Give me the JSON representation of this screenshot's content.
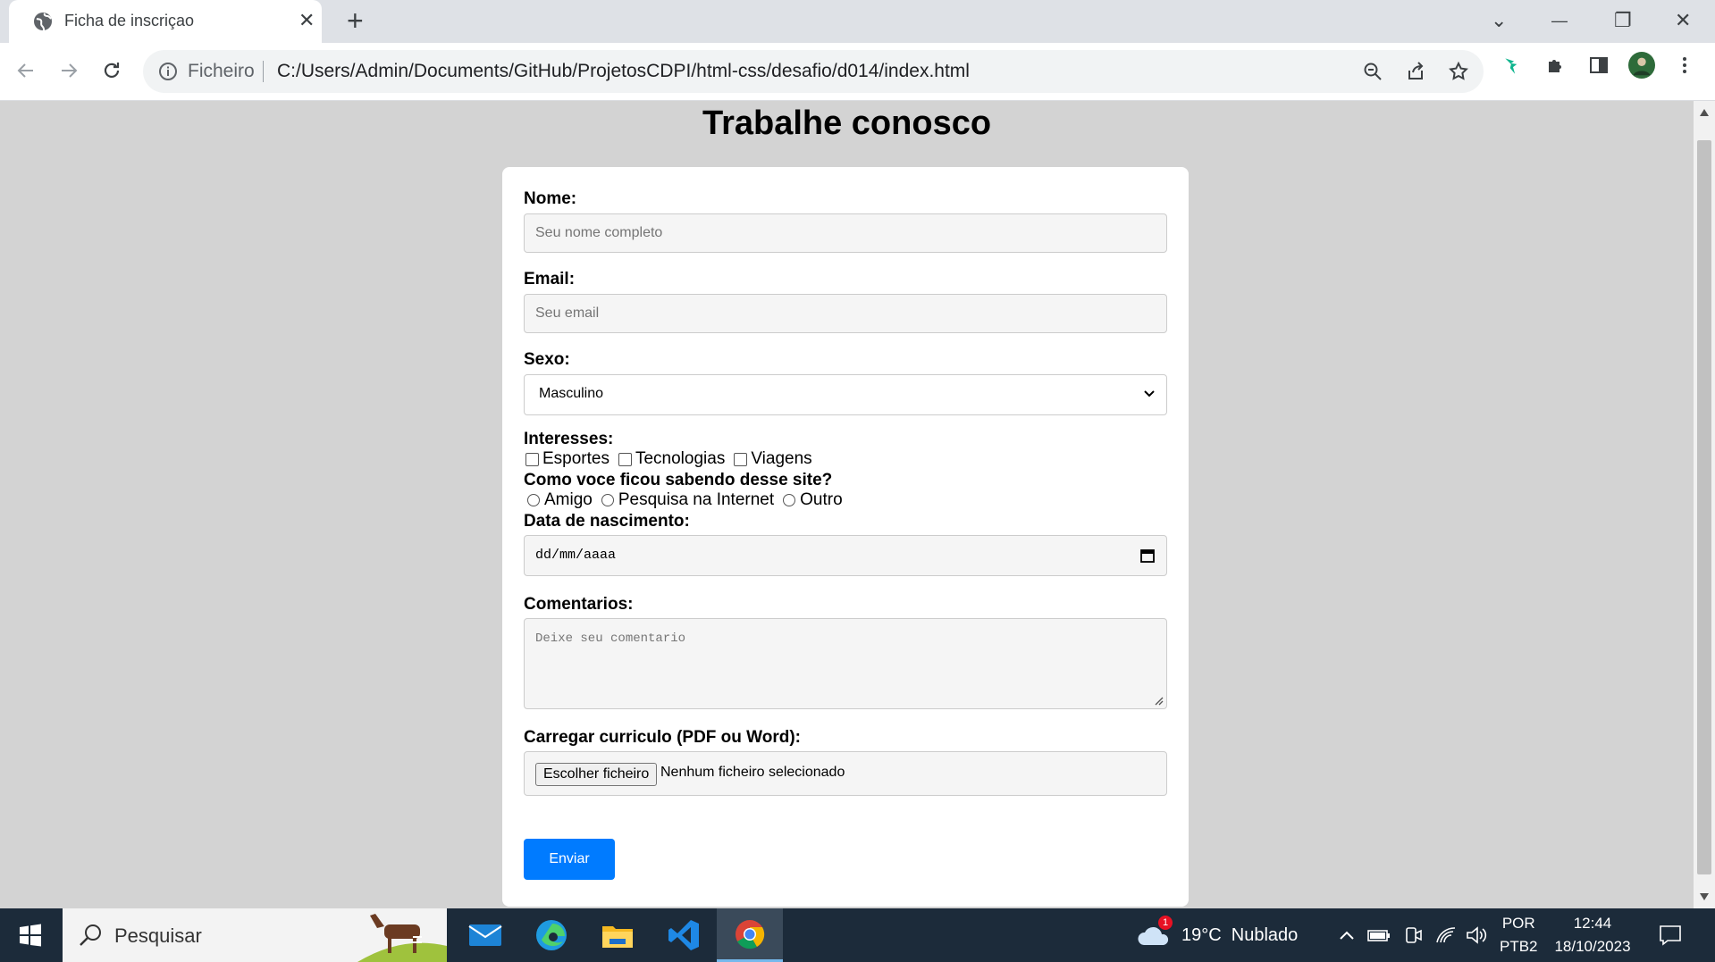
{
  "browser": {
    "tab_title": "Ficha de inscriçao",
    "tab_close": "✕",
    "new_tab": "+",
    "window_controls": {
      "dropdown": "⌄",
      "minimize": "—",
      "restore": "❐",
      "close": "✕"
    },
    "address_chip": "Ficheiro",
    "url": "C:/Users/Admin/Documents/GitHub/ProjetosCDPI/html-css/desafio/d014/index.html"
  },
  "page": {
    "title": "Trabalhe conosco",
    "form": {
      "nome_label": "Nome:",
      "nome_placeholder": "Seu nome completo",
      "email_label": "Email:",
      "email_placeholder": "Seu email",
      "sexo_label": "Sexo:",
      "sexo_value": "Masculino",
      "interesses_label": "Interesses:",
      "interesses": [
        "Esportes",
        "Tecnologias",
        "Viagens"
      ],
      "como_label": "Como voce ficou sabendo desse site?",
      "como_opcoes": [
        "Amigo",
        "Pesquisa na Internet",
        "Outro"
      ],
      "data_label": "Data de nascimento:",
      "data_placeholder": "dd/mm/aaaa",
      "comentarios_label": "Comentarios:",
      "comentarios_placeholder": "Deixe seu comentario",
      "curriculo_label": "Carregar curriculo (PDF ou Word):",
      "file_button": "Escolher ficheiro",
      "file_status": "Nenhum ficheiro selecionado",
      "submit_label": "Enviar"
    }
  },
  "taskbar": {
    "search_text": "Pesquisar",
    "weather_badge": "1",
    "weather": "19°C  Nublado",
    "lang_top": "POR",
    "lang_bottom": "PTB2",
    "time": "12:44",
    "date": "18/10/2023"
  },
  "colors": {
    "accent": "#007bff",
    "page_bg": "#d3d3d3",
    "taskbar": "#1c2b3a"
  }
}
